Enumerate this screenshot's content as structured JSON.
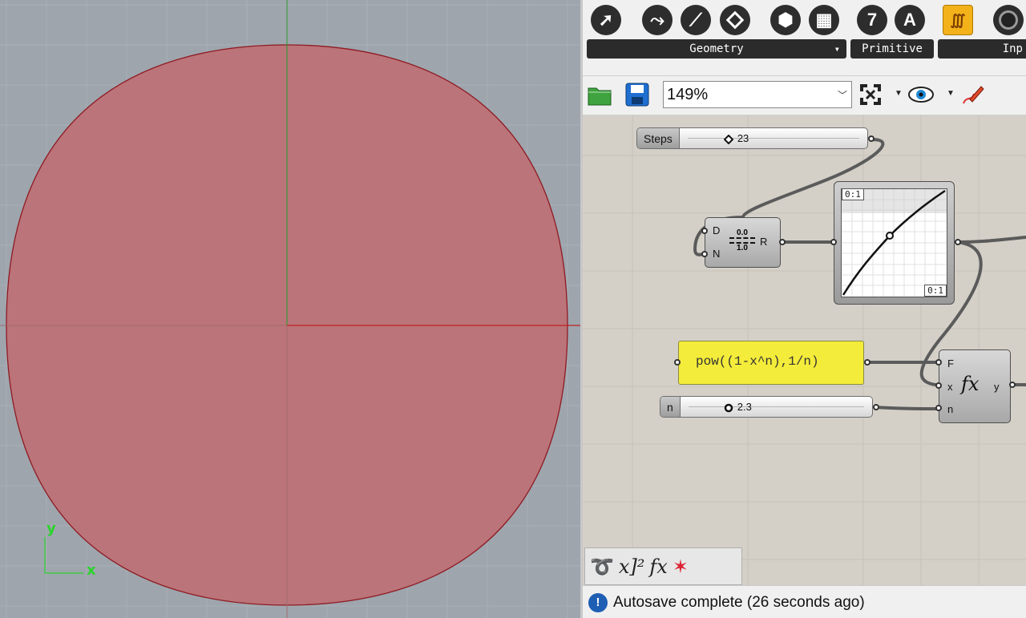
{
  "viewport": {
    "shape_fill": "#bb7479",
    "shape_stroke": "#8e1a22",
    "x_axis_color": "#c02020",
    "y_axis_color": "#2a9a2a",
    "background": "#9ea5ad",
    "x_label": "x",
    "y_label": "y"
  },
  "ribbon": {
    "groups": [
      {
        "label": "Geometry",
        "has_dropdown": true
      },
      {
        "label": "Primitive",
        "has_dropdown": false
      },
      {
        "label": "Inp",
        "has_dropdown": false
      }
    ],
    "icons": [
      "vector-icon",
      "curve-icon",
      "line-icon",
      "rectangle-icon",
      "brep-icon",
      "mesh-icon",
      "integer-icon",
      "text-icon",
      "params-icon",
      "input-icon"
    ],
    "integer_glyph": "7",
    "text_glyph": "A"
  },
  "toolbar": {
    "zoom": "149%"
  },
  "canvas": {
    "steps_slider": {
      "name": "Steps",
      "value": "23"
    },
    "range_component": {
      "inputs": [
        "D",
        "N"
      ],
      "output": "R",
      "icon_top": "0.0",
      "icon_bottom": "1.0"
    },
    "graph_mapper": {
      "top_tag": "0:1",
      "bottom_tag": "0:1"
    },
    "expression_panel": {
      "text": "pow((1-x^n),1/n)"
    },
    "n_slider": {
      "name": "n",
      "value": "2.3"
    },
    "expression_component": {
      "inputs": [
        "F",
        "x",
        "n"
      ],
      "output": "y",
      "icon": "f(x)"
    }
  },
  "widgets": [
    "sketch-widget",
    "power-widget",
    "function-widget",
    "bouquet-widget"
  ],
  "status": {
    "text": "Autosave complete (26 seconds ago)"
  }
}
